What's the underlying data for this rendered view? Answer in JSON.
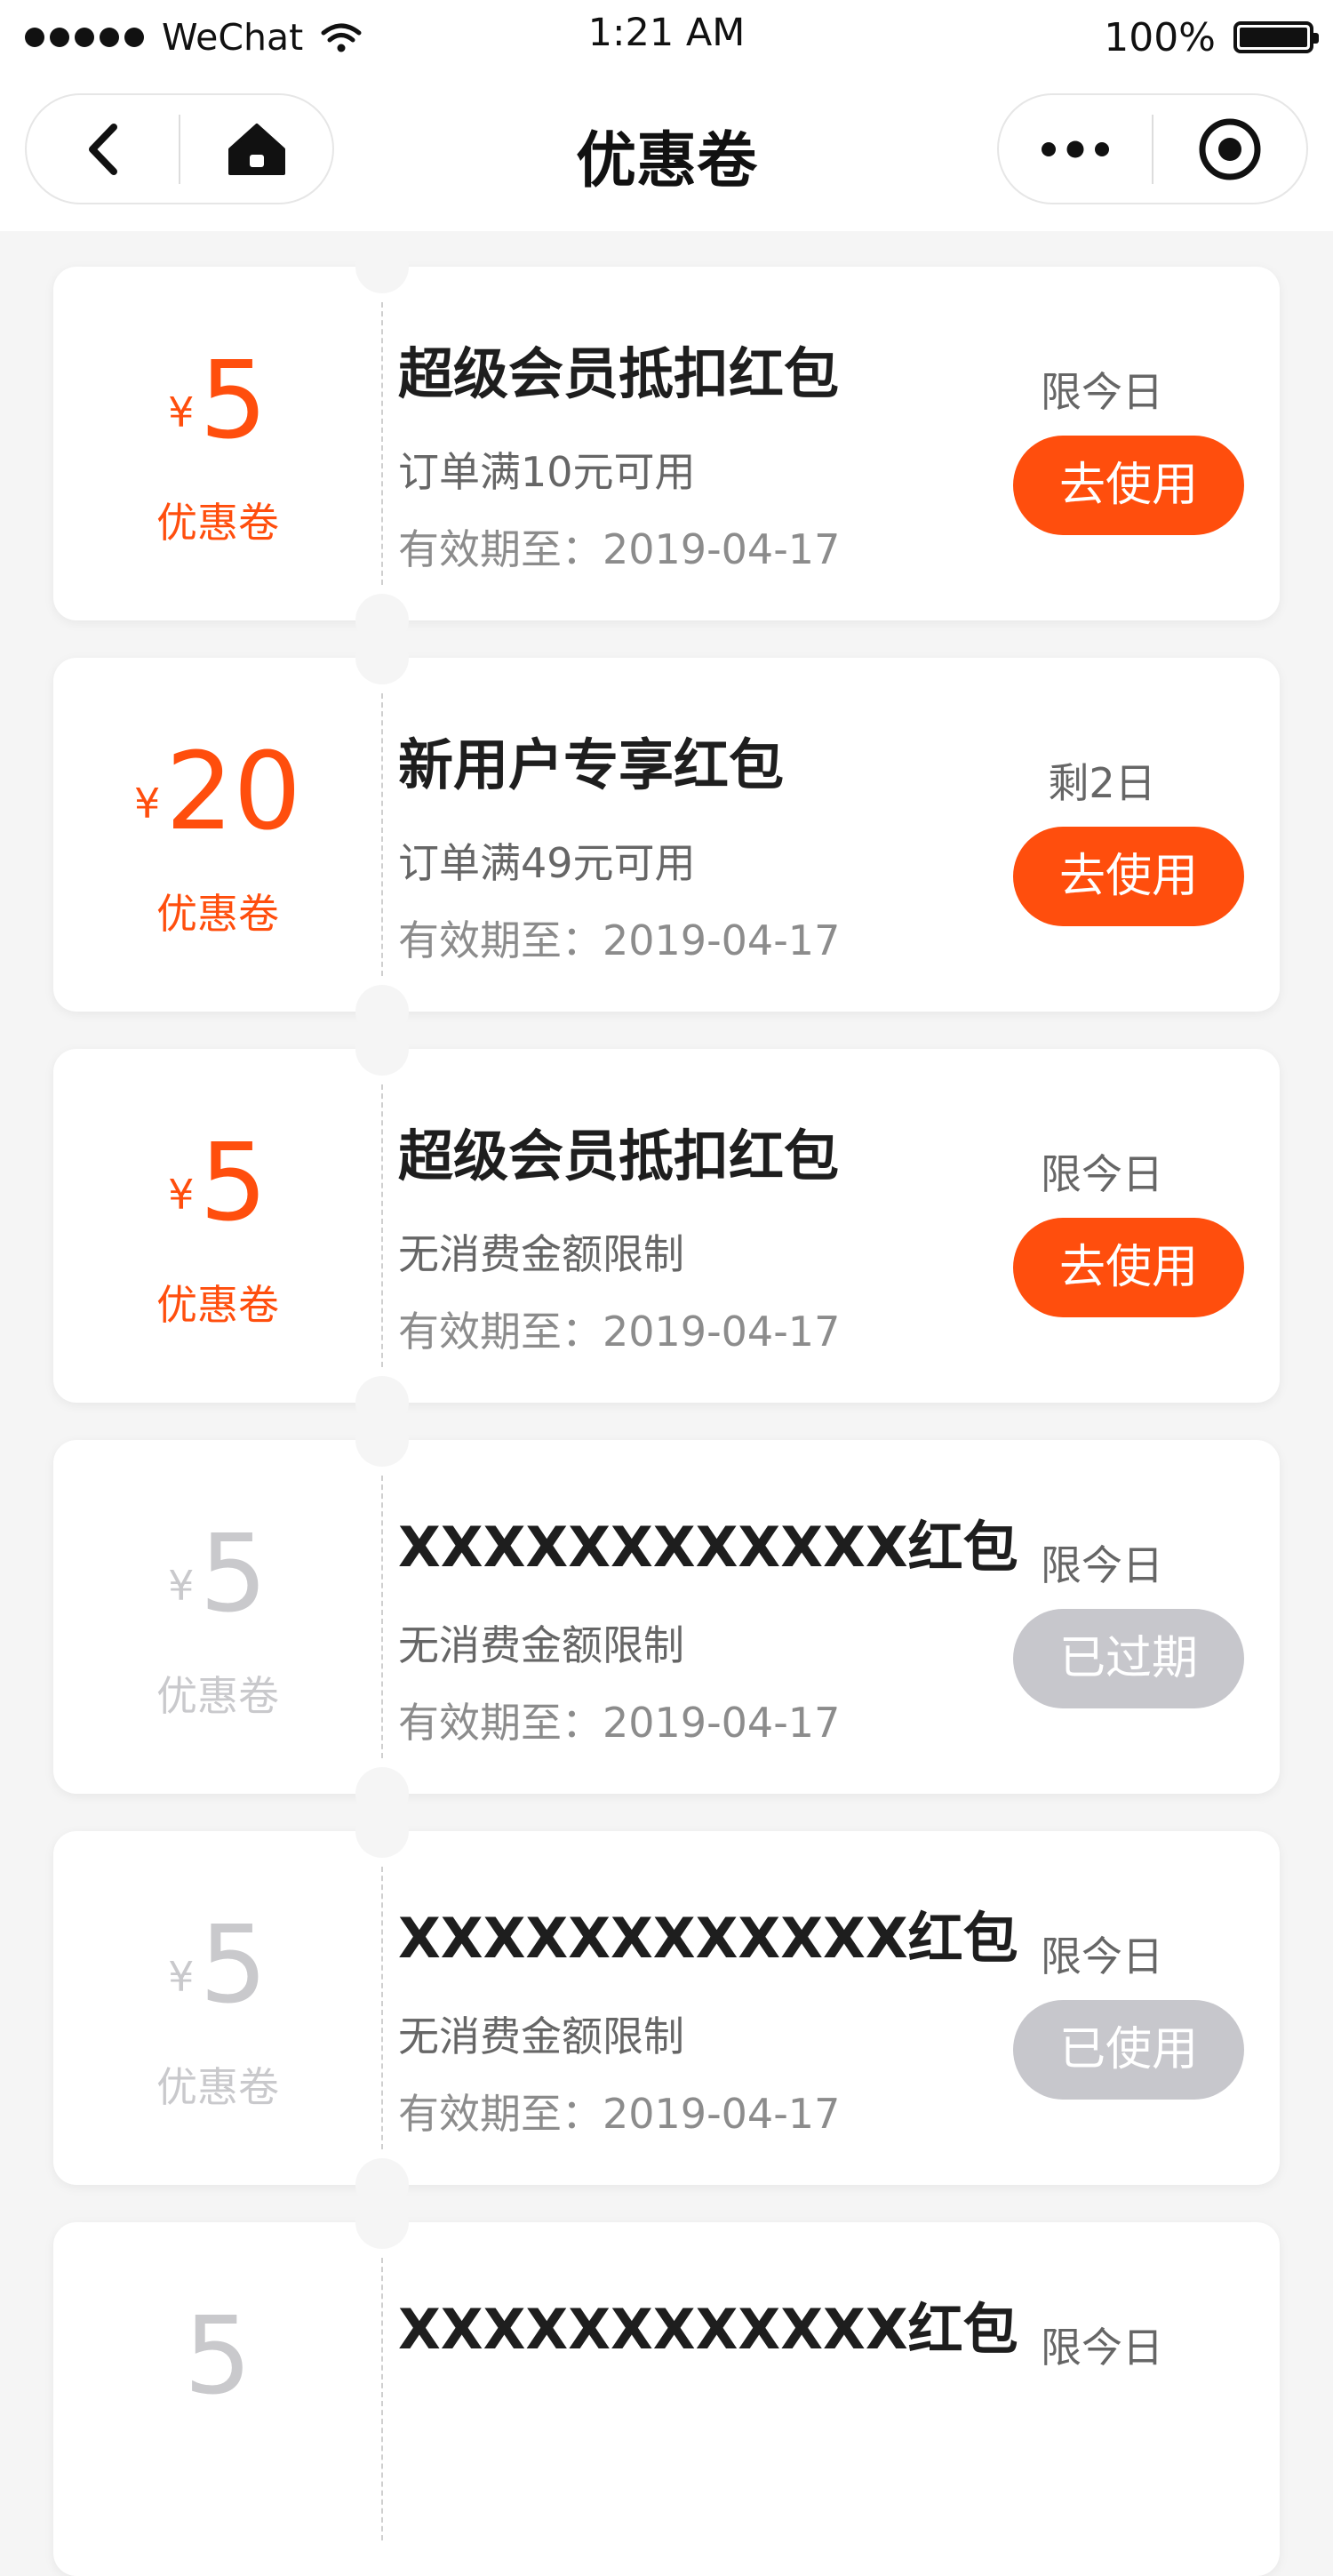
{
  "status_bar": {
    "carrier": "WeChat",
    "time": "1:21 AM",
    "battery": "100%"
  },
  "nav": {
    "title": "优惠卷"
  },
  "coupons": [
    {
      "currency": "¥",
      "amount": "5",
      "amount_label": "优惠卷",
      "title": "超级会员抵扣红包",
      "condition": "订单满10元可用",
      "expiry": "有效期至：2019-04-17",
      "limit": "限今日",
      "action": "去使用",
      "state": "active"
    },
    {
      "currency": "¥",
      "amount": "20",
      "amount_label": "优惠卷",
      "title": "新用户专享红包",
      "condition": "订单满49元可用",
      "expiry": "有效期至：2019-04-17",
      "limit": "剩2日",
      "action": "去使用",
      "state": "active"
    },
    {
      "currency": "¥",
      "amount": "5",
      "amount_label": "优惠卷",
      "title": "超级会员抵扣红包",
      "condition": "无消费金额限制",
      "expiry": "有效期至：2019-04-17",
      "limit": "限今日",
      "action": "去使用",
      "state": "active"
    },
    {
      "currency": "¥",
      "amount": "5",
      "amount_label": "优惠卷",
      "title": "XXXXXXXXXXXX红包",
      "condition": "无消费金额限制",
      "expiry": "有效期至：2019-04-17",
      "limit": "限今日",
      "action": "已过期",
      "state": "expired"
    },
    {
      "currency": "¥",
      "amount": "5",
      "amount_label": "优惠卷",
      "title": "XXXXXXXXXXXX红包",
      "condition": "无消费金额限制",
      "expiry": "有效期至：2019-04-17",
      "limit": "限今日",
      "action": "已使用",
      "state": "used"
    },
    {
      "currency": "¥",
      "amount": "5",
      "amount_label": "",
      "title": "XXXXXXXXXXXX红包",
      "condition": "",
      "expiry": "",
      "limit": "限今日",
      "action": "",
      "state": "partial"
    }
  ],
  "colors": {
    "accent": "#ff4e0d",
    "disabled": "#c7c7cc",
    "background": "#f5f5f5"
  },
  "icons": {
    "back": "chevron-left-icon",
    "home": "home-icon",
    "more": "more-dots-icon",
    "close": "target-circle-icon"
  }
}
